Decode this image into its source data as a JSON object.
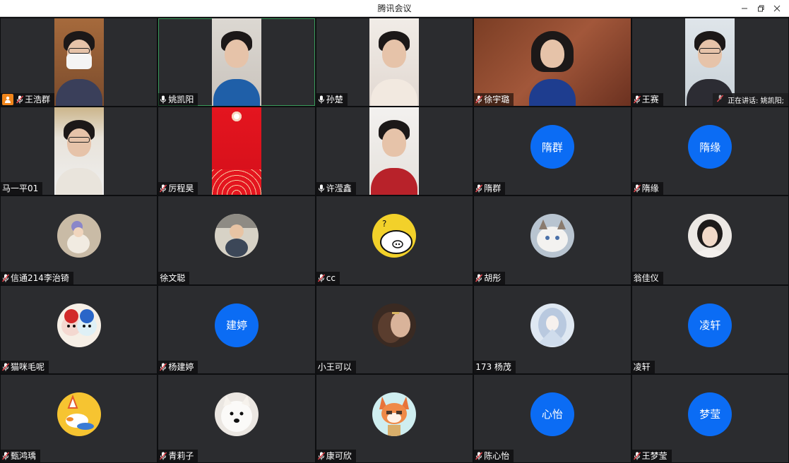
{
  "window": {
    "title": "腾讯会议",
    "controls": [
      "minimize-icon",
      "restore-icon",
      "close-icon"
    ]
  },
  "speaking": {
    "label": "正在讲话: 姚凯阳;"
  },
  "participants": [
    {
      "name": "王浩群",
      "mic": "muted",
      "host": true,
      "display": "video",
      "video_theme": "masked"
    },
    {
      "name": "姚凯阳",
      "mic": "on",
      "host": false,
      "display": "video",
      "video_theme": "blue-shirt",
      "active_speaker": true
    },
    {
      "name": "孙楚",
      "mic": "on",
      "host": false,
      "display": "video",
      "video_theme": "light-room"
    },
    {
      "name": "徐宇璐",
      "mic": "muted",
      "host": false,
      "display": "video-wide",
      "video_theme": "wood-wall"
    },
    {
      "name": "王赛",
      "mic": "muted",
      "host": false,
      "display": "video",
      "video_theme": "glasses-office"
    },
    {
      "name": "马一平01",
      "mic": "none",
      "host": false,
      "display": "video",
      "video_theme": "glasses-man"
    },
    {
      "name": "厉程昊",
      "mic": "muted",
      "host": false,
      "display": "video",
      "video_theme": "red-cover"
    },
    {
      "name": "许滢鑫",
      "mic": "on",
      "host": false,
      "display": "video",
      "video_theme": "red-jacket"
    },
    {
      "name": "隋群",
      "mic": "muted",
      "host": false,
      "display": "text-avatar",
      "avatar_text": "隋群"
    },
    {
      "name": "隋缘",
      "mic": "muted",
      "host": false,
      "display": "text-avatar",
      "avatar_text": "隋缘"
    },
    {
      "name": "信通214李治锜",
      "mic": "muted",
      "host": false,
      "display": "image-avatar",
      "avatar_icon": "child-photo-icon"
    },
    {
      "name": "徐文聪",
      "mic": "none",
      "host": false,
      "display": "image-avatar",
      "avatar_icon": "baby-photo-icon"
    },
    {
      "name": "cc",
      "mic": "muted",
      "host": false,
      "display": "image-avatar",
      "avatar_icon": "pig-cartoon-icon"
    },
    {
      "name": "胡彤",
      "mic": "muted",
      "host": false,
      "display": "image-avatar",
      "avatar_icon": "cat-photo-icon"
    },
    {
      "name": "翁佳仪",
      "mic": "none",
      "host": false,
      "display": "image-avatar",
      "avatar_icon": "girl-photo-icon"
    },
    {
      "name": "猫咪毛呢",
      "mic": "muted",
      "host": false,
      "display": "image-avatar",
      "avatar_icon": "opera-mask-icon"
    },
    {
      "name": "杨建婷",
      "mic": "muted",
      "host": false,
      "display": "text-avatar",
      "avatar_text": "建婷"
    },
    {
      "name": "小王可以",
      "mic": "none",
      "host": false,
      "display": "image-avatar",
      "avatar_icon": "hug-photo-icon"
    },
    {
      "name": "173 杨茂",
      "mic": "none",
      "host": false,
      "display": "image-avatar",
      "avatar_icon": "anime-girl-icon"
    },
    {
      "name": "凌轩",
      "mic": "none",
      "host": false,
      "display": "text-avatar",
      "avatar_text": "凌轩"
    },
    {
      "name": "甄鸿瑀",
      "mic": "muted",
      "host": false,
      "display": "image-avatar",
      "avatar_icon": "duck-cartoon-icon"
    },
    {
      "name": "青莉子",
      "mic": "muted",
      "host": false,
      "display": "image-avatar",
      "avatar_icon": "dog-photo-icon"
    },
    {
      "name": "康可欣",
      "mic": "muted",
      "host": false,
      "display": "image-avatar",
      "avatar_icon": "fox-cartoon-icon"
    },
    {
      "name": "陈心怡",
      "mic": "muted",
      "host": false,
      "display": "text-avatar",
      "avatar_text": "心怡"
    },
    {
      "name": "王梦莹",
      "mic": "muted",
      "host": false,
      "display": "text-avatar",
      "avatar_text": "梦莹"
    }
  ],
  "colors": {
    "tile_bg": "#2b2c2f",
    "avatar_blue": "#0b6cf4",
    "host_badge": "#f0851b",
    "muted_mic": "#e0464d",
    "active_border": "#3a9b5b"
  }
}
